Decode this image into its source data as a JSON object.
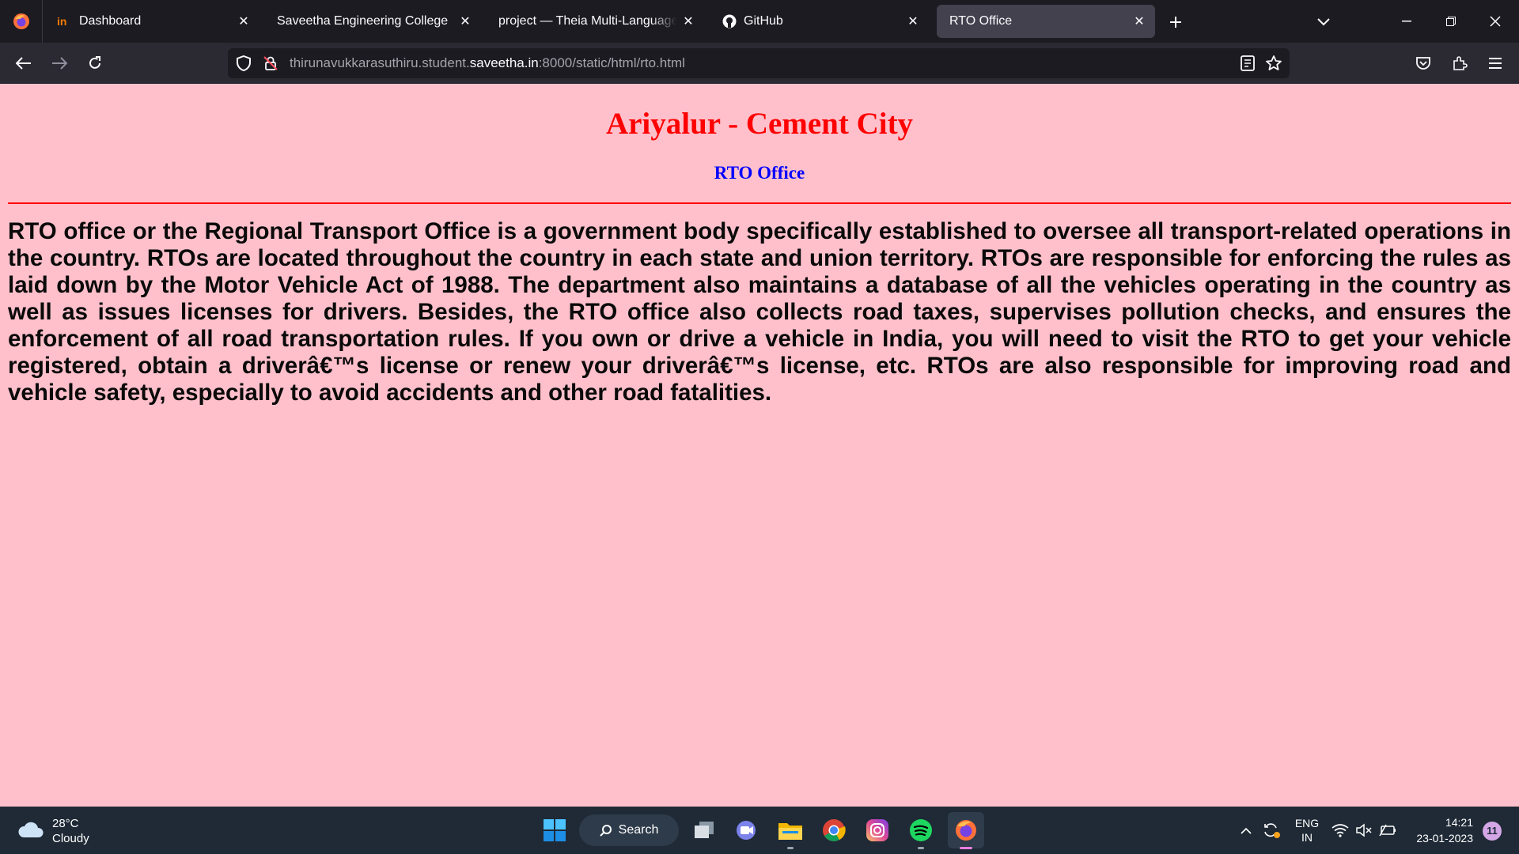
{
  "browser": {
    "tabs": [
      {
        "label": "Dashboard",
        "icon": "in-icon"
      },
      {
        "label": "Saveetha Engineering College",
        "icon": "none"
      },
      {
        "label": "project — Theia Multi-Language Ex",
        "icon": "none"
      },
      {
        "label": "GitHub",
        "icon": "github-icon"
      },
      {
        "label": "RTO Office",
        "icon": "none",
        "active": true
      }
    ],
    "url_prefix": "thirunavukkarasuthiru.student.",
    "url_domain": "saveetha.in",
    "url_suffix": ":8000/static/html/rto.html"
  },
  "page": {
    "background": "#ffc0cb",
    "heading": "Ariyalur - Cement City",
    "heading_color": "#ff0000",
    "subheading": "RTO Office",
    "subheading_color": "#0000ff",
    "body": "RTO office or the Regional Transport Office is a government body specifically established to oversee all transport-related operations in the country. RTOs are located throughout the country in each state and union territory. RTOs are responsible for enforcing the rules as laid down by the Motor Vehicle Act of 1988. The department also maintains a database of all the vehicles operating in the country as well as issues licenses for drivers. Besides, the RTO office also collects road taxes, supervises pollution checks, and ensures the enforcement of all road transportation rules. If you own or drive a vehicle in India, you will need to visit the RTO to get your vehicle registered, obtain a driverâ€™s license or renew your driverâ€™s license, etc. RTOs are also responsible for improving road and vehicle safety, especially to avoid accidents and other road fatalities."
  },
  "taskbar": {
    "weather_temp": "28°C",
    "weather_desc": "Cloudy",
    "search_label": "Search",
    "lang_line1": "ENG",
    "lang_line2": "IN",
    "time": "14:21",
    "date": "23-01-2023",
    "notification_count": "11"
  }
}
